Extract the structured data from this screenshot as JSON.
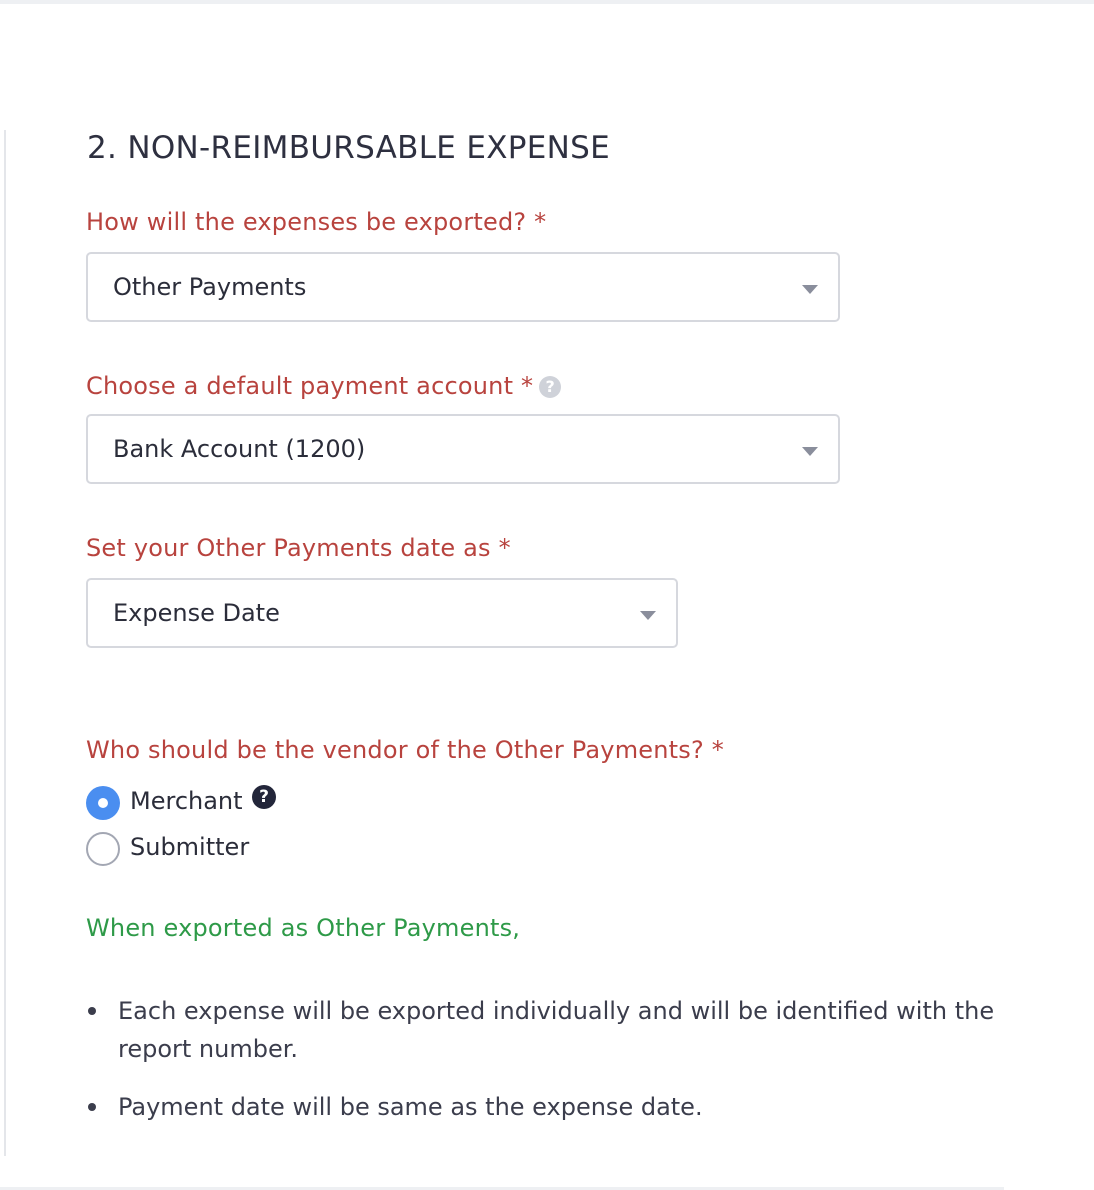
{
  "section": {
    "title": "2. NON-REIMBURSABLE EXPENSE"
  },
  "export_method": {
    "label": "How will the expenses be exported? *",
    "value": "Other Payments"
  },
  "payment_account": {
    "label": "Choose a default payment account *",
    "help_glyph": "?",
    "value": "Bank Account (1200)"
  },
  "payment_date": {
    "label": "Set your Other Payments date as *",
    "value": "Expense Date"
  },
  "vendor": {
    "label": "Who should be the vendor of the Other Payments? *",
    "options": [
      {
        "label": "Merchant",
        "selected": true,
        "help_glyph": "?"
      },
      {
        "label": "Submitter",
        "selected": false
      }
    ]
  },
  "info": {
    "heading": "When exported as Other Payments,",
    "items": [
      "Each expense will be exported individually and will be identified with the report number.",
      "Payment date will be same as the expense date."
    ]
  },
  "colors": {
    "label_red": "#b8433e",
    "info_green": "#2e9a48",
    "radio_blue": "#4a8ef0"
  }
}
